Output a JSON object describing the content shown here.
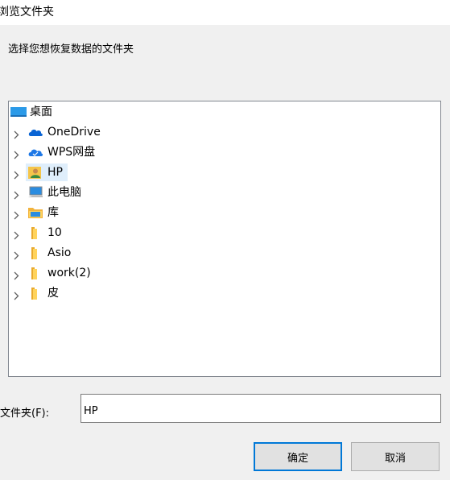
{
  "window": {
    "title": "浏览文件夹"
  },
  "instruction": "选择您想恢复数据的文件夹",
  "tree": {
    "root": {
      "label": "桌面",
      "icon": "desktop-icon"
    },
    "items": [
      {
        "label": "OneDrive",
        "icon": "onedrive-cloud-icon"
      },
      {
        "label": "WPS网盘",
        "icon": "wps-cloud-icon"
      },
      {
        "label": "HP",
        "icon": "user-folder-icon",
        "selected": true
      },
      {
        "label": "此电脑",
        "icon": "computer-icon"
      },
      {
        "label": "库",
        "icon": "library-icon"
      },
      {
        "label": "10",
        "icon": "folder-icon"
      },
      {
        "label": "Asio",
        "icon": "folder-icon"
      },
      {
        "label": "work(2)",
        "icon": "folder-icon"
      },
      {
        "label": "皮",
        "icon": "folder-icon"
      }
    ]
  },
  "folder": {
    "label": "文件夹(F):",
    "value": "HP"
  },
  "buttons": {
    "ok": "确定",
    "cancel": "取消"
  },
  "colors": {
    "selection": "#dfeefb",
    "accent": "#0078d7",
    "folder": "#ffd35c"
  }
}
